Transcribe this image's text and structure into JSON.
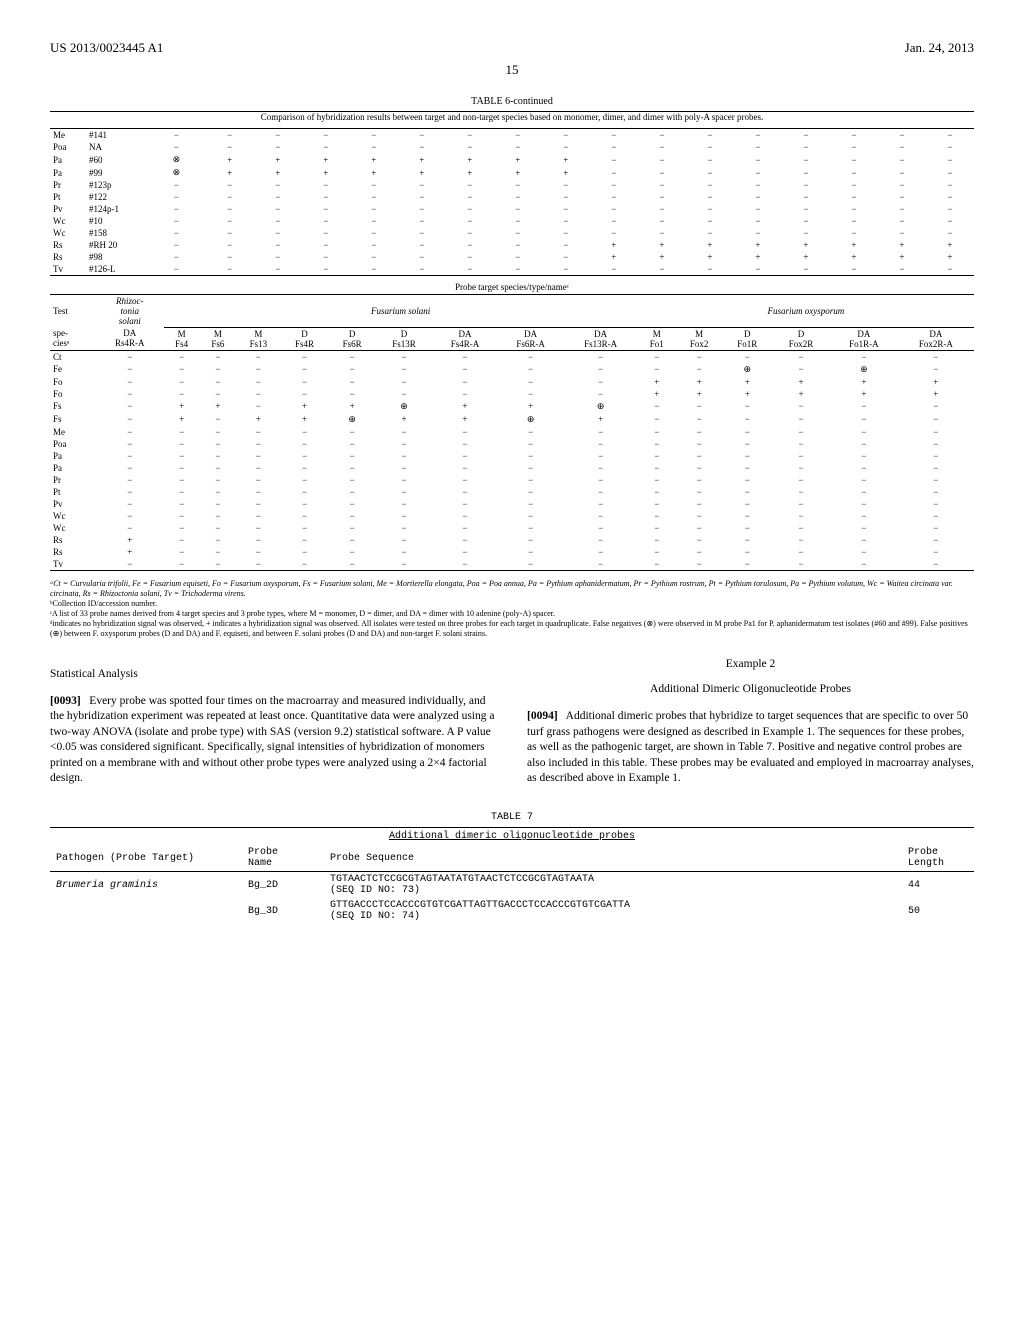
{
  "header": {
    "pub_no": "US 2013/0023445 A1",
    "date": "Jan. 24, 2013",
    "page": "15"
  },
  "table6": {
    "title": "TABLE 6-continued",
    "caption": "Comparison of hybridization results between target and non-target species based on monomer, dimer, and dimer with poly-A spacer probes.",
    "rows_top": [
      {
        "sp": "Me",
        "id": "#141",
        "v": [
          "−",
          "−",
          "−",
          "−",
          "−",
          "−",
          "−",
          "−",
          "−",
          "−",
          "−",
          "−",
          "−",
          "−",
          "−",
          "−",
          "−"
        ]
      },
      {
        "sp": "Poa",
        "id": "NA",
        "v": [
          "−",
          "−",
          "−",
          "−",
          "−",
          "−",
          "−",
          "−",
          "−",
          "−",
          "−",
          "−",
          "−",
          "−",
          "−",
          "−",
          "−"
        ]
      },
      {
        "sp": "Pa",
        "id": "#60",
        "v": [
          "⊗",
          "+",
          "+",
          "+",
          "+",
          "+",
          "+",
          "+",
          "+",
          "−",
          "−",
          "−",
          "−",
          "−",
          "−",
          "−",
          "−"
        ]
      },
      {
        "sp": "Pa",
        "id": "#99",
        "v": [
          "⊗",
          "+",
          "+",
          "+",
          "+",
          "+",
          "+",
          "+",
          "+",
          "−",
          "−",
          "−",
          "−",
          "−",
          "−",
          "−",
          "−"
        ]
      },
      {
        "sp": "Pr",
        "id": "#123p",
        "v": [
          "−",
          "−",
          "−",
          "−",
          "−",
          "−",
          "−",
          "−",
          "−",
          "−",
          "−",
          "−",
          "−",
          "−",
          "−",
          "−",
          "−"
        ]
      },
      {
        "sp": "Pt",
        "id": "#122",
        "v": [
          "−",
          "−",
          "−",
          "−",
          "−",
          "−",
          "−",
          "−",
          "−",
          "−",
          "−",
          "−",
          "−",
          "−",
          "−",
          "−",
          "−"
        ]
      },
      {
        "sp": "Pv",
        "id": "#124p-1",
        "v": [
          "−",
          "−",
          "−",
          "−",
          "−",
          "−",
          "−",
          "−",
          "−",
          "−",
          "−",
          "−",
          "−",
          "−",
          "−",
          "−",
          "−"
        ]
      },
      {
        "sp": "Wc",
        "id": "#10",
        "v": [
          "−",
          "−",
          "−",
          "−",
          "−",
          "−",
          "−",
          "−",
          "−",
          "−",
          "−",
          "−",
          "−",
          "−",
          "−",
          "−",
          "−"
        ]
      },
      {
        "sp": "Wc",
        "id": "#158",
        "v": [
          "−",
          "−",
          "−",
          "−",
          "−",
          "−",
          "−",
          "−",
          "−",
          "−",
          "−",
          "−",
          "−",
          "−",
          "−",
          "−",
          "−"
        ]
      },
      {
        "sp": "Rs",
        "id": "#RH 20",
        "v": [
          "−",
          "−",
          "−",
          "−",
          "−",
          "−",
          "−",
          "−",
          "−",
          "+",
          "+",
          "+",
          "+",
          "+",
          "+",
          "+",
          "+"
        ]
      },
      {
        "sp": "Rs",
        "id": "#98",
        "v": [
          "−",
          "−",
          "−",
          "−",
          "−",
          "−",
          "−",
          "−",
          "−",
          "+",
          "+",
          "+",
          "+",
          "+",
          "+",
          "+",
          "+"
        ]
      },
      {
        "sp": "Tv",
        "id": "#126-L",
        "v": [
          "−",
          "−",
          "−",
          "−",
          "−",
          "−",
          "−",
          "−",
          "−",
          "−",
          "−",
          "−",
          "−",
          "−",
          "−",
          "−",
          "−"
        ]
      }
    ],
    "sec_head": "Probe target species/type/nameᶜ",
    "group_labels": {
      "rhizo": "Rhizoc-\ntonia\nsolani",
      "fsol": "Fusarium solani",
      "foxy": "Fusarium oxysporum"
    },
    "test_label": "Test",
    "species_label": "spe-\nciesᵃ",
    "cols2": [
      "DA\nRs4R-A",
      "M\nFs4",
      "M\nFs6",
      "M\nFs13",
      "D\nFs4R",
      "D\nFs6R",
      "D\nFs13R",
      "DA\nFs4R-A",
      "DA\nFs6R-A",
      "DA\nFs13R-A",
      "M\nFo1",
      "M\nFox2",
      "D\nFo1R",
      "D\nFox2R",
      "DA\nFo1R-A",
      "DA\nFox2R-A"
    ],
    "rows_bot": [
      {
        "sp": "Ct",
        "v": [
          "−",
          "−",
          "−",
          "−",
          "−",
          "−",
          "−",
          "−",
          "−",
          "−",
          "−",
          "−",
          "−",
          "−",
          "−",
          "−"
        ]
      },
      {
        "sp": "Fe",
        "v": [
          "−",
          "−",
          "−",
          "−",
          "−",
          "−",
          "−",
          "−",
          "−",
          "−",
          "−",
          "−",
          "⊕",
          "−",
          "⊕",
          "−"
        ]
      },
      {
        "sp": "Fo",
        "v": [
          "−",
          "−",
          "−",
          "−",
          "−",
          "−",
          "−",
          "−",
          "−",
          "−",
          "+",
          "+",
          "+",
          "+",
          "+",
          "+"
        ]
      },
      {
        "sp": "Fo",
        "v": [
          "−",
          "−",
          "−",
          "−",
          "−",
          "−",
          "−",
          "−",
          "−",
          "−",
          "+",
          "+",
          "+",
          "+",
          "+",
          "+"
        ]
      },
      {
        "sp": "Fs",
        "v": [
          "−",
          "+",
          "+",
          "−",
          "+",
          "+",
          "⊕",
          "+",
          "+",
          "⊕",
          "−",
          "−",
          "−",
          "−",
          "−",
          "−"
        ]
      },
      {
        "sp": "Fs",
        "v": [
          "−",
          "+",
          "−",
          "+",
          "+",
          "⊕",
          "+",
          "+",
          "⊕",
          "+",
          "−",
          "−",
          "−",
          "−",
          "−",
          "−"
        ]
      },
      {
        "sp": "Me",
        "v": [
          "−",
          "−",
          "−",
          "−",
          "−",
          "−",
          "−",
          "−",
          "−",
          "−",
          "−",
          "−",
          "−",
          "−",
          "−",
          "−"
        ]
      },
      {
        "sp": "Poa",
        "v": [
          "−",
          "−",
          "−",
          "−",
          "−",
          "−",
          "−",
          "−",
          "−",
          "−",
          "−",
          "−",
          "−",
          "−",
          "−",
          "−"
        ]
      },
      {
        "sp": "Pa",
        "v": [
          "−",
          "−",
          "−",
          "−",
          "−",
          "−",
          "−",
          "−",
          "−",
          "−",
          "−",
          "−",
          "−",
          "−",
          "−",
          "−"
        ]
      },
      {
        "sp": "Pa",
        "v": [
          "−",
          "−",
          "−",
          "−",
          "−",
          "−",
          "−",
          "−",
          "−",
          "−",
          "−",
          "−",
          "−",
          "−",
          "−",
          "−"
        ]
      },
      {
        "sp": "Pr",
        "v": [
          "−",
          "−",
          "−",
          "−",
          "−",
          "−",
          "−",
          "−",
          "−",
          "−",
          "−",
          "−",
          "−",
          "−",
          "−",
          "−"
        ]
      },
      {
        "sp": "Pt",
        "v": [
          "−",
          "−",
          "−",
          "−",
          "−",
          "−",
          "−",
          "−",
          "−",
          "−",
          "−",
          "−",
          "−",
          "−",
          "−",
          "−"
        ]
      },
      {
        "sp": "Pv",
        "v": [
          "−",
          "−",
          "−",
          "−",
          "−",
          "−",
          "−",
          "−",
          "−",
          "−",
          "−",
          "−",
          "−",
          "−",
          "−",
          "−"
        ]
      },
      {
        "sp": "Wc",
        "v": [
          "−",
          "−",
          "−",
          "−",
          "−",
          "−",
          "−",
          "−",
          "−",
          "−",
          "−",
          "−",
          "−",
          "−",
          "−",
          "−"
        ]
      },
      {
        "sp": "Wc",
        "v": [
          "−",
          "−",
          "−",
          "−",
          "−",
          "−",
          "−",
          "−",
          "−",
          "−",
          "−",
          "−",
          "−",
          "−",
          "−",
          "−"
        ]
      },
      {
        "sp": "Rs",
        "v": [
          "+",
          "−",
          "−",
          "−",
          "−",
          "−",
          "−",
          "−",
          "−",
          "−",
          "−",
          "−",
          "−",
          "−",
          "−",
          "−"
        ]
      },
      {
        "sp": "Rs",
        "v": [
          "+",
          "−",
          "−",
          "−",
          "−",
          "−",
          "−",
          "−",
          "−",
          "−",
          "−",
          "−",
          "−",
          "−",
          "−",
          "−"
        ]
      },
      {
        "sp": "Tv",
        "v": [
          "−",
          "−",
          "−",
          "−",
          "−",
          "−",
          "−",
          "−",
          "−",
          "−",
          "−",
          "−",
          "−",
          "−",
          "−",
          "−"
        ]
      }
    ],
    "footnotes": {
      "a": "ᵃCt = Curvularia trifolii, Fe = Fusarium equiseti, Fo = Fusarium oxysporum, Fs = Fusarium solani, Me = Mortierella elongata, Poa = Poa annua, Pa = Pythium aphanidermatum, Pr = Pythium rostrum, Pt = Pythium torulosum, Pa = Pythium volutum, Wc = Waitea circinata var. circinata, Rs = Rhizoctonia solani, Tv = Trichoderma virens.",
      "b": "ᵇCollection ID/accession number.",
      "c": "ᶜA list of 33 probe names derived from 4 target species and 3 probe types, where M = monomer, D = dimer, and DA = dimer with 10 adenine (poly-A) spacer.",
      "d": "ᵈindicates no hybridization signal was observed, + indicates a hybridization signal was observed. All isolates were tested on three probes for each target in quadruplicate. False negatives (⊗) were observed in M probe Pa1 for P. aphanidermatum test isolates (#60 and #99). False positives (⊕) between F. oxysporum probes (D and DA) and F. equiseti, and between F. solani probes (D and DA) and non-target F. solani strains."
    }
  },
  "left": {
    "heading": "Statistical Analysis",
    "para_num": "[0093]",
    "body": "Every probe was spotted four times on the macroarray and measured individually, and the hybridization experiment was repeated at least once. Quantitative data were analyzed using a two-way ANOVA (isolate and probe type) with SAS (version 9.2) statistical software. A P value <0.05 was considered significant. Specifically, signal intensities of hybridization of monomers printed on a membrane with and without other probe types were analyzed using a 2×4 factorial design."
  },
  "right": {
    "ex": "Example 2",
    "title": "Additional Dimeric Oligonucleotide Probes",
    "para_num": "[0094]",
    "body": "Additional dimeric probes that hybridize to target sequences that are specific to over 50 turf grass pathogens were designed as described in Example 1. The sequences for these probes, as well as the pathogenic target, are shown in Table 7. Positive and negative control probes are also included in this table. These probes may be evaluated and employed in macroarray analyses, as described above in Example 1."
  },
  "table7": {
    "title": "TABLE 7",
    "caption": "Additional dimeric oligonucleotide probes",
    "cols": {
      "target": "Pathogen (Probe Target)",
      "name": "Probe\nName",
      "seq": "Probe Sequence",
      "len": "Probe\nLength"
    },
    "rows": [
      {
        "target": "Brumeria graminis",
        "name": "Bg_2D",
        "seq": "TGTAACTCTCCGCGTAGTAATATGTAACTCTCCGCGTAGTAATA",
        "seqid": "(SEQ ID NO: 73)",
        "len": "44"
      },
      {
        "target": "",
        "name": "Bg_3D",
        "seq": "GTTGACCCTCCACCCGTGTCGATTAGTTGACCCTCCACCCGTGTCGATTA",
        "seqid": "(SEQ ID NO: 74)",
        "len": "50"
      }
    ]
  }
}
